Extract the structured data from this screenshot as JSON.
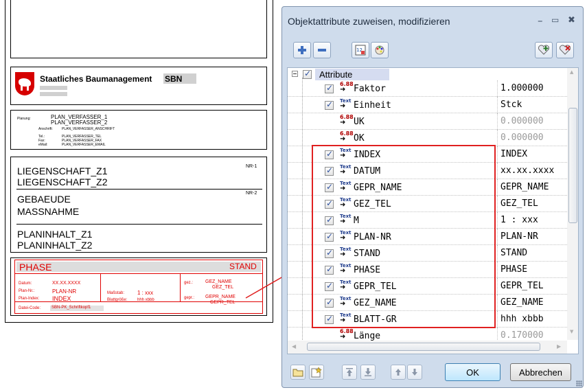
{
  "drawing": {
    "org_name": "Staatliches Baumanagement",
    "org_code": "SBN",
    "planung_label": "Planung:",
    "verfasser_1": "PLAN_VERFASSER_1",
    "verfasser_2": "PLAN_VERFASSER_2",
    "anschrift_label": "Anschrift:",
    "anschrift_value": "PLAN_VERFASSER_ANSCHRIFT",
    "tel_label": "Tel.:",
    "tel_value": "PLAN_VERFASSER_TEL",
    "fax_label": "Fax:",
    "fax_value": "PLAN_VERFASSER_FAX",
    "email_label": "eMail:",
    "email_value": "PLAN_VERFASSER_EMAIL",
    "nr1": "NR-1",
    "nr2": "NR-2",
    "liegenschaft_1": "LIEGENSCHAFT_Z1",
    "liegenschaft_2": "LIEGENSCHAFT_Z2",
    "gebaeude": "GEBAEUDE",
    "massnahme": "MASSNAHME",
    "planinhalt_1": "PLANINHALT_Z1",
    "planinhalt_2": "PLANINHALT_Z2",
    "phase": "PHASE",
    "stand": "STAND",
    "datum_label": "Datum:",
    "datum_value": "XX.XX.XXXX",
    "plannr_label": "Plan-Nr.:",
    "plannr_value": "PLAN-NR",
    "planindex_label": "Plan-Index:",
    "planindex_value": "INDEX",
    "massstab_label": "Maßstab:",
    "massstab_value": "1 : xxx",
    "blattgroesse_label": "Blattgröße:",
    "blattgroesse_value": "hhh xbbb",
    "gez_label": "gez.:",
    "gez_name": "GEZ_NAME",
    "gez_tel": "GEZ_TEL",
    "gepr_label": "gepr.:",
    "gepr_name": "GEPR_NAME",
    "gepr_tel": "GEPR_TEL",
    "dateicode_label": "Datei-Code:",
    "dateicode_value": "SBN-PK_Schriftkopf1"
  },
  "dialog": {
    "title": "Objektattribute zuweisen, modifizieren",
    "minimize": "–",
    "maximize": "▭",
    "close": "✖",
    "tree_root_label": "Attribute",
    "ok_label": "OK",
    "cancel_label": "Abbrechen",
    "rows": [
      {
        "name": "Faktor",
        "value": "1.000000",
        "type": "number",
        "checkbox": true,
        "checked": true
      },
      {
        "name": "Einheit",
        "value": "Stck",
        "type": "text",
        "checkbox": true,
        "checked": true
      },
      {
        "name": "UK",
        "value": "0.000000",
        "type": "number",
        "checkbox": false,
        "checked": false
      },
      {
        "name": "OK",
        "value": "0.000000",
        "type": "number",
        "checkbox": false,
        "checked": false
      },
      {
        "name": "INDEX",
        "value": "INDEX",
        "type": "text",
        "checkbox": true,
        "checked": true
      },
      {
        "name": "DATUM",
        "value": "xx.xx.xxxx",
        "type": "text",
        "checkbox": true,
        "checked": true
      },
      {
        "name": "GEPR_NAME",
        "value": "GEPR_NAME",
        "type": "text",
        "checkbox": true,
        "checked": true
      },
      {
        "name": "GEZ_TEL",
        "value": "GEZ_TEL",
        "type": "text",
        "checkbox": true,
        "checked": true
      },
      {
        "name": "M",
        "value": "1 : xxx",
        "type": "text",
        "checkbox": true,
        "checked": true
      },
      {
        "name": "PLAN-NR",
        "value": "PLAN-NR",
        "type": "text",
        "checkbox": true,
        "checked": true
      },
      {
        "name": "STAND",
        "value": "STAND",
        "type": "text",
        "checkbox": true,
        "checked": true
      },
      {
        "name": "PHASE",
        "value": "PHASE",
        "type": "text",
        "checkbox": true,
        "checked": true
      },
      {
        "name": "GEPR_TEL",
        "value": "GEPR_TEL",
        "type": "text",
        "checkbox": true,
        "checked": true
      },
      {
        "name": "GEZ_NAME",
        "value": "GEZ_NAME",
        "type": "text",
        "checkbox": true,
        "checked": true
      },
      {
        "name": "BLATT-GR",
        "value": "hhh xbbb",
        "type": "text",
        "checkbox": true,
        "checked": true
      },
      {
        "name": "Länge",
        "value": "0.170000",
        "type": "number",
        "checkbox": false,
        "checked": false
      }
    ],
    "icons": {
      "number_glyph": "6.88",
      "text_glyph": "Text"
    },
    "colors": {
      "highlight": "#e02020",
      "dialog_bg": "#cfdcec"
    }
  }
}
